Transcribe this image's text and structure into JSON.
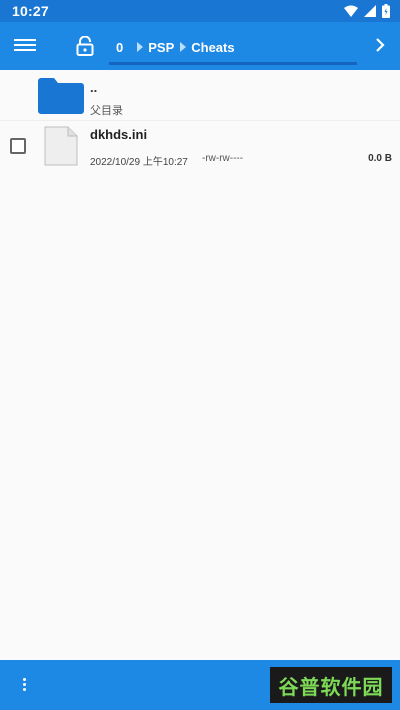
{
  "status_bar": {
    "time": "10:27"
  },
  "toolbar": {
    "breadcrumbs": [
      "0",
      "PSP",
      "Cheats"
    ]
  },
  "files": {
    "parent": {
      "name": "..",
      "label": "父目录"
    },
    "items": [
      {
        "name": "dkhds.ini",
        "date": "2022/10/29 上午10:27",
        "permissions": "-rw-rw----",
        "size": "0.0 B"
      }
    ]
  },
  "watermark": "谷普软件园",
  "colors": {
    "toolbar": "#1e88e5",
    "status": "#1976d2",
    "folder": "#1976d2"
  }
}
